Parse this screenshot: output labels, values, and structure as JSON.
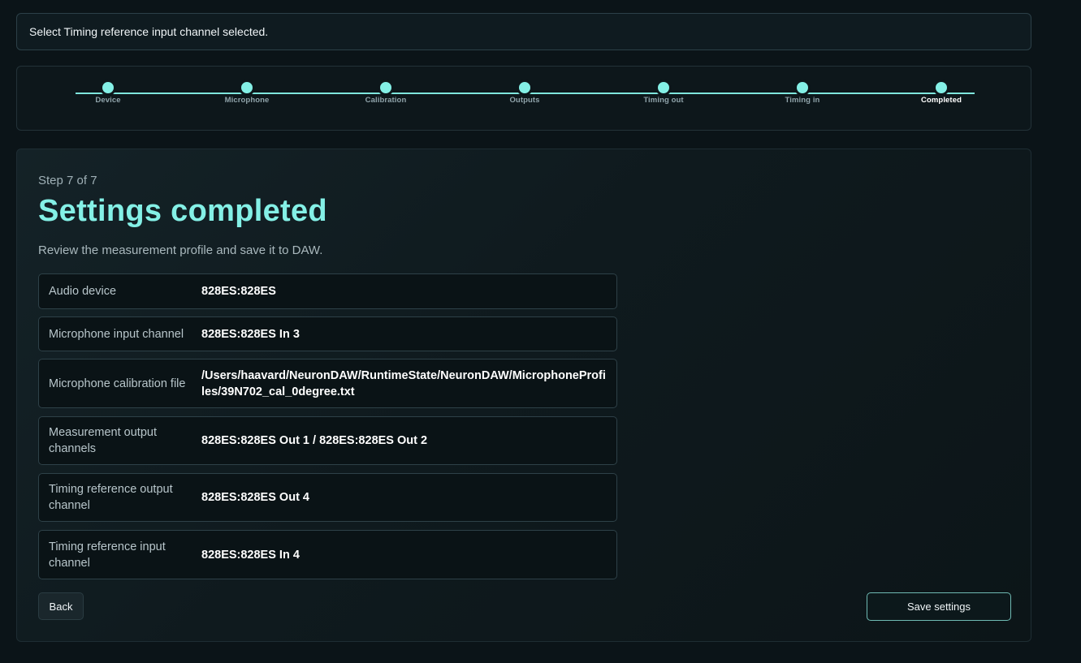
{
  "status": {
    "message": "Select Timing reference input channel selected."
  },
  "stepper": {
    "steps": [
      {
        "label": "Device"
      },
      {
        "label": "Microphone"
      },
      {
        "label": "Calibration"
      },
      {
        "label": "Outputs"
      },
      {
        "label": "Timing out"
      },
      {
        "label": "Timing in"
      },
      {
        "label": "Completed"
      }
    ],
    "current_step": 7
  },
  "main": {
    "step_count": "Step 7 of 7",
    "title": "Settings completed",
    "description": "Review the measurement profile and save it to DAW.",
    "summary": [
      {
        "label": "Audio device",
        "value": "828ES:828ES"
      },
      {
        "label": "Microphone input channel",
        "value": "828ES:828ES In 3"
      },
      {
        "label": "Microphone calibration file",
        "value": "/Users/haavard/NeuronDAW/RuntimeState/NeuronDAW/MicrophoneProfiles/39N702_cal_0degree.txt"
      },
      {
        "label": "Measurement output channels",
        "value": "828ES:828ES Out 1 / 828ES:828ES Out 2"
      },
      {
        "label": "Timing reference output channel",
        "value": "828ES:828ES Out 4"
      },
      {
        "label": "Timing reference input channel",
        "value": "828ES:828ES In 4"
      }
    ],
    "back_label": "Back",
    "save_label": "Save settings"
  },
  "colors": {
    "accent": "#84f0e6",
    "background": "#0b1418"
  }
}
